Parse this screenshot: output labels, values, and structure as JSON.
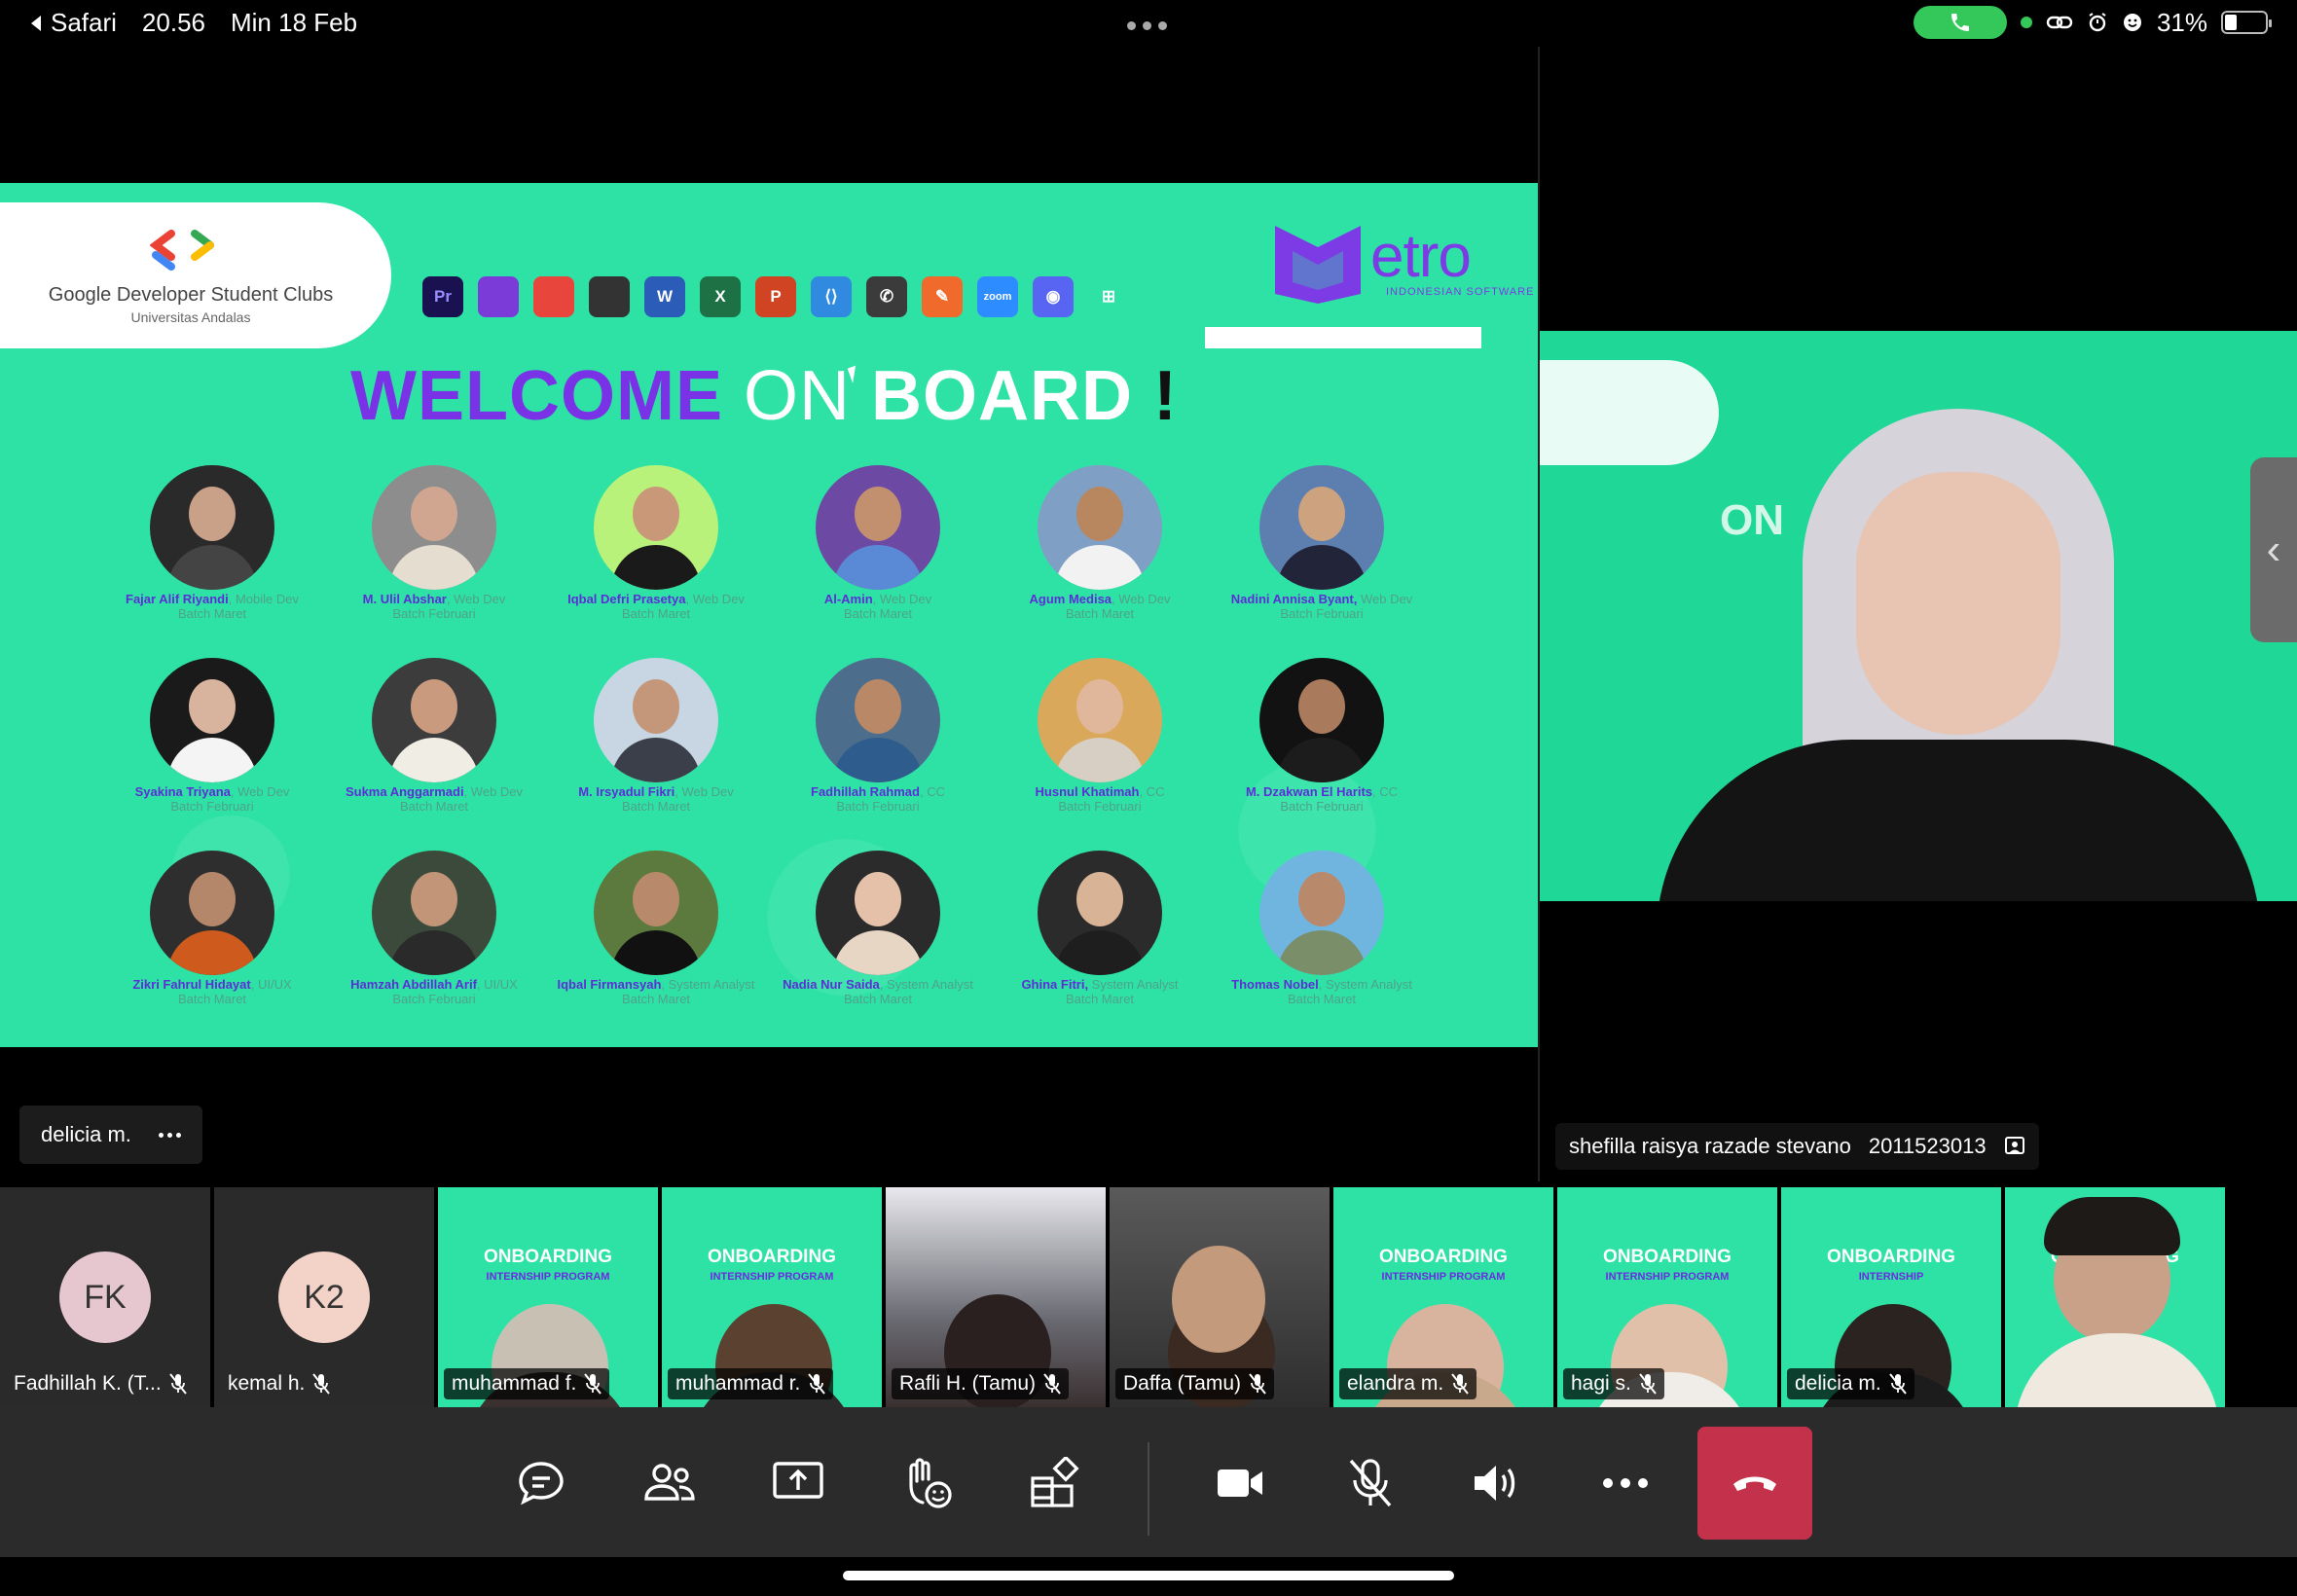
{
  "status_bar": {
    "back_app": "Safari",
    "time": "20.56",
    "date": "Min 18 Feb",
    "battery": "31%",
    "battery_level": 0.31
  },
  "shared_screen": {
    "gdsc_title": "Google Developer Student Clubs",
    "gdsc_sub": "Universitas Andalas",
    "metro_word": "etro",
    "metro_sub": "INDONESIAN SOFTWARE",
    "welcome": {
      "w1": "WELCOME",
      "w2": "ON",
      "w3": "BOARD",
      "w4": "!"
    },
    "tools": [
      {
        "label": "Pr",
        "name": "premiere-icon",
        "bg": "#1a1250",
        "fg": "#9a8cff"
      },
      {
        "label": "",
        "name": "github-icon",
        "bg": "#7a3bd8",
        "fg": "#fff"
      },
      {
        "label": "",
        "name": "chrome-icon",
        "bg": "#e8453c",
        "fg": "#fff"
      },
      {
        "label": "",
        "name": "dart-icon",
        "bg": "#333",
        "fg": "#ffc107"
      },
      {
        "label": "W",
        "name": "word-icon",
        "bg": "#2b5cb8",
        "fg": "#fff"
      },
      {
        "label": "X",
        "name": "excel-icon",
        "bg": "#1e7145",
        "fg": "#fff"
      },
      {
        "label": "P",
        "name": "powerpoint-icon",
        "bg": "#d04423",
        "fg": "#fff"
      },
      {
        "label": "⟨⟩",
        "name": "vscode-icon",
        "bg": "#2f8ae0",
        "fg": "#fff"
      },
      {
        "label": "✆",
        "name": "whatsapp-icon",
        "bg": "#3b3b3b",
        "fg": "#fff"
      },
      {
        "label": "✎",
        "name": "figma-icon",
        "bg": "#f06a2c",
        "fg": "#fff"
      },
      {
        "label": "zoom",
        "name": "zoom-icon",
        "bg": "#2d8cff",
        "fg": "#fff"
      },
      {
        "label": "◉",
        "name": "discord-icon",
        "bg": "#5865f2",
        "fg": "#fff"
      },
      {
        "label": "⊞",
        "name": "windows-icon",
        "bg": "transparent",
        "fg": "#fff"
      }
    ],
    "members": [
      {
        "name": "Fajar Alif Riyandi",
        "role": ", Mobile Dev",
        "batch": "Batch Maret",
        "bg": "#2a2a2a",
        "skin": "#c9a088",
        "shirt": "#444"
      },
      {
        "name": "M. Ulil Abshar",
        "role": ", Web Dev",
        "batch": "Batch Februari",
        "bg": "#8d8d8d",
        "skin": "#d0a690",
        "shirt": "#e4ddd0"
      },
      {
        "name": "Iqbal Defri Prasetya",
        "role": ", Web Dev",
        "batch": "Batch Maret",
        "bg": "#b8f27a",
        "skin": "#c99879",
        "shirt": "#1a1a1a"
      },
      {
        "name": "Al-Amin",
        "role": ", Web Dev",
        "batch": "Batch Maret",
        "bg": "#6c4aa3",
        "skin": "#c2906f",
        "shirt": "#5a8ad6"
      },
      {
        "name": "Agum Medisa",
        "role": ", Web Dev",
        "batch": "Batch Maret",
        "bg": "#7fa0c4",
        "skin": "#b9875f",
        "shirt": "#f2f2f2"
      },
      {
        "name": "Nadini Annisa Byant,",
        "role": " Web Dev",
        "batch": "Batch Februari",
        "bg": "#5d7fb0",
        "skin": "#cda27f",
        "shirt": "#22243a"
      },
      {
        "name": "Syakina Triyana",
        "role": ", Web Dev",
        "batch": "Batch Februari",
        "bg": "#1a1a1a",
        "skin": "#d8b49e",
        "shirt": "#f4f4f4"
      },
      {
        "name": "Sukma Anggarmadi",
        "role": ", Web Dev",
        "batch": "Batch Maret",
        "bg": "#3c3c3c",
        "skin": "#c99a7e",
        "shirt": "#f0ede4"
      },
      {
        "name": "M. Irsyadul Fikri",
        "role": ", Web Dev",
        "batch": "Batch Maret",
        "bg": "#c8d6e4",
        "skin": "#c4977a",
        "shirt": "#3b3f4a"
      },
      {
        "name": "Fadhillah Rahmad",
        "role": ", CC",
        "batch": "Batch Februari",
        "bg": "#4c6e8c",
        "skin": "#b98866",
        "shirt": "#2e5c8c"
      },
      {
        "name": "Husnul Khatimah",
        "role": ", CC",
        "batch": "Batch Februari",
        "bg": "#d9a85a",
        "skin": "#e0b79a",
        "shirt": "#d7cfc4"
      },
      {
        "name": "M. Dzakwan El Harits",
        "role": ", CC",
        "batch": "Batch Februari",
        "bg": "#121212",
        "skin": "#a97a5c",
        "shirt": "#1c1c1c"
      },
      {
        "name": "Zikri Fahrul Hidayat",
        "role": ", UI/UX",
        "batch": "Batch Maret",
        "bg": "#2e2e2e",
        "skin": "#b5876a",
        "shirt": "#cf5a1e"
      },
      {
        "name": "Hamzah Abdillah Arif",
        "role": ", UI/UX",
        "batch": "Batch Februari",
        "bg": "#3b4a3a",
        "skin": "#c29578",
        "shirt": "#2a2a2a"
      },
      {
        "name": "Iqbal Firmansyah",
        "role": ", System Analyst",
        "batch": "Batch Maret",
        "bg": "#5c7a3e",
        "skin": "#b8896a",
        "shirt": "#111"
      },
      {
        "name": "Nadia Nur Saida",
        "role": ", System Analyst",
        "batch": "Batch Maret",
        "bg": "#2b2b2b",
        "skin": "#e4c1a8",
        "shirt": "#e8d6c4"
      },
      {
        "name": "Ghina Fitri,",
        "role": " System Analyst",
        "batch": "Batch Maret",
        "bg": "#2b2b2b",
        "skin": "#d9b395",
        "shirt": "#1e1e1e"
      },
      {
        "name": "Thomas Nobel",
        "role": ", System Analyst",
        "batch": "Batch Maret",
        "bg": "#6fb5e0",
        "skin": "#b9896b",
        "shirt": "#7a8e6a"
      }
    ]
  },
  "presenter_label": {
    "name": "delicia m."
  },
  "speaker": {
    "name": "shefilla raisya razade stevano",
    "id": "2011523013",
    "bg_text": "ON"
  },
  "participants": [
    {
      "name": "Fadhillah K. (T...",
      "initials": "FK",
      "type": "avatar",
      "avatar_bg": "#e6c7d0"
    },
    {
      "name": "kemal h.",
      "initials": "K2",
      "type": "avatar",
      "avatar_bg": "#f3d3c8"
    },
    {
      "name": "muhammad f.",
      "type": "onboard",
      "ob1": "ONBOARDING",
      "ob2": "INTERNSHIP PROGRAM"
    },
    {
      "name": "muhammad r.",
      "type": "onboard",
      "ob1": "ONBOARDING",
      "ob2": "INTERNSHIP PROGRAM"
    },
    {
      "name": "Rafli H. (Tamu)",
      "type": "video"
    },
    {
      "name": "Daffa (Tamu)",
      "type": "video"
    },
    {
      "name": "elandra m.",
      "type": "onboard",
      "ob1": "ONBOARDING",
      "ob2": "INTERNSHIP PROGRAM"
    },
    {
      "name": "hagi s.",
      "type": "onboard",
      "ob1": "ONBOARDING",
      "ob2": "INTERNSHIP PROGRAM"
    },
    {
      "name": "delicia m.",
      "type": "onboard",
      "ob1": "ONBOARDING",
      "ob2": "INTERNSHIP"
    },
    {
      "name": "",
      "type": "self",
      "ob1": "ONBOARDING",
      "ob2": ""
    }
  ],
  "colors": {
    "slide_green": "#2ee2a5",
    "brand_purple": "#7a32e6",
    "end_call_red": "#c4314b",
    "toolbar_bg": "#2b2b2b"
  }
}
